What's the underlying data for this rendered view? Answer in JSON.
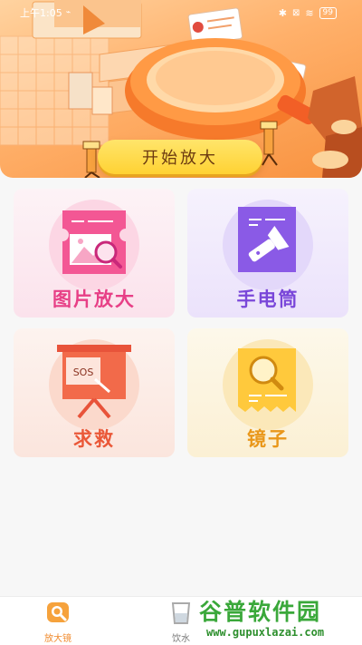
{
  "status_bar": {
    "time": "上午1:05",
    "battery": "99"
  },
  "hero": {
    "start_button_label": "开始放大"
  },
  "features": [
    {
      "label": "图片放大",
      "icon": "image-zoom-icon"
    },
    {
      "label": "手电筒",
      "icon": "flashlight-icon"
    },
    {
      "label": "求救",
      "icon": "sos-board-icon"
    },
    {
      "label": "镜子",
      "icon": "mirror-icon"
    }
  ],
  "sos_text": "SOS",
  "bottom_nav": {
    "items": [
      {
        "label": "放大镜",
        "icon": "magnifier-icon",
        "active": true
      },
      {
        "label": "饮水",
        "icon": "cup-icon",
        "active": false
      }
    ]
  },
  "watermark": {
    "title": "谷普软件园",
    "url": "www.gupuxlazai.com"
  },
  "colors": {
    "accent": "#f08a2c",
    "pink": "#e73f86",
    "purple": "#7a47d9",
    "red": "#ea5838",
    "yellow": "#e9971a"
  }
}
